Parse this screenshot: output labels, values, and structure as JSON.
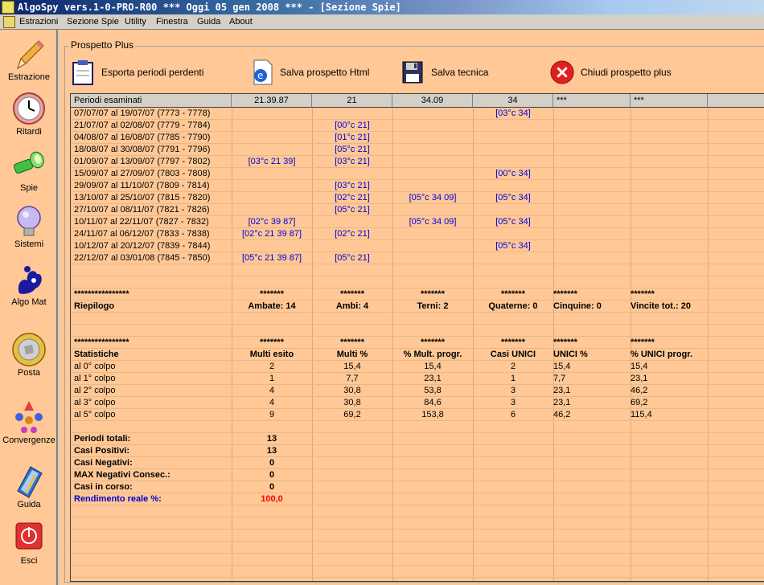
{
  "window": {
    "title": "AlgoSpy vers.1-0-PRO-R00  ***  Oggi 05 gen 2008  ***   - [Sezione Spie]"
  },
  "menu": [
    "Estrazioni",
    "Sezione Spie",
    "Utility",
    "Finestra",
    "Guida",
    "About"
  ],
  "sidebar": [
    {
      "label": "Estrazione",
      "icon": "pencil-icon"
    },
    {
      "label": "Ritardi",
      "icon": "clock-icon"
    },
    {
      "label": "Spie",
      "icon": "flashlight-icon"
    },
    {
      "label": "Sistemi",
      "icon": "lightbulb-icon"
    },
    {
      "label": "Algo Mat",
      "icon": "lottery-hand-icon"
    },
    {
      "label": "Posta",
      "icon": "coin-icon"
    },
    {
      "label": "Convergenze",
      "icon": "convergence-icon"
    },
    {
      "label": "Guida",
      "icon": "book-icon"
    },
    {
      "label": "Esci",
      "icon": "exit-icon"
    }
  ],
  "panel": {
    "title": "Prospetto Plus"
  },
  "toolbar": {
    "export": "Esporta periodi perdenti",
    "save_html": "Salva prospetto Html",
    "save_tech": "Salva tecnica",
    "close": "Chiudi prospetto plus"
  },
  "grid": {
    "headers": [
      "Periodi esaminati",
      "21.39.87",
      "21",
      "34.09",
      "34",
      "***",
      "***"
    ],
    "rows": [
      [
        "07/07/07 al 19/07/07  (7773 - 7778)",
        "",
        "",
        "",
        "[03°c 34]",
        "",
        ""
      ],
      [
        "21/07/07 al 02/08/07  (7779 - 7784)",
        "",
        "[00°c 21]",
        "",
        "",
        "",
        ""
      ],
      [
        "04/08/07 al 16/08/07  (7785 - 7790)",
        "",
        "[01°c 21]",
        "",
        "",
        "",
        ""
      ],
      [
        "18/08/07 al 30/08/07  (7791 - 7796)",
        "",
        "[05°c 21]",
        "",
        "",
        "",
        ""
      ],
      [
        "01/09/07 al 13/09/07  (7797 - 7802)",
        "[03°c 21 39]",
        "[03°c 21]",
        "",
        "",
        "",
        ""
      ],
      [
        "15/09/07 al 27/09/07  (7803 - 7808)",
        "",
        "",
        "",
        "[00°c 34]",
        "",
        ""
      ],
      [
        "29/09/07 al 11/10/07  (7809 - 7814)",
        "",
        "[03°c 21]",
        "",
        "",
        "",
        ""
      ],
      [
        "13/10/07 al 25/10/07  (7815 - 7820)",
        "",
        "[02°c 21]",
        "[05°c 34 09]",
        "[05°c 34]",
        "",
        ""
      ],
      [
        "27/10/07 al 08/11/07  (7821 - 7826)",
        "",
        "[05°c 21]",
        "",
        "",
        "",
        ""
      ],
      [
        "10/11/07 al 22/11/07  (7827 - 7832)",
        "[02°c 39 87]",
        "",
        "[05°c 34 09]",
        "[05°c 34]",
        "",
        ""
      ],
      [
        "24/11/07 al 06/12/07  (7833 - 7838)",
        "[02°c 21 39 87]",
        "[02°c 21]",
        "",
        "",
        "",
        ""
      ],
      [
        "10/12/07 al 20/12/07  (7839 - 7844)",
        "",
        "",
        "",
        "[05°c 34]",
        "",
        ""
      ],
      [
        "22/12/07 al 03/01/08  (7845 - 7850)",
        "[05°c 21 39 87]",
        "[05°c 21]",
        "",
        "",
        "",
        ""
      ]
    ],
    "summary_stars": [
      "****************",
      "*******",
      "*******",
      "*******",
      "*******",
      "*******",
      "*******"
    ],
    "summary": [
      "Riepilogo",
      "Ambate: 14",
      "Ambi: 4",
      "Terni: 2",
      "Quaterne: 0",
      "Cinquine: 0",
      "Vincite tot.: 20"
    ],
    "stats_stars": [
      "****************",
      "*******",
      "*******",
      "*******",
      "*******",
      "*******",
      "*******"
    ],
    "stats_header": [
      "Statistiche",
      "Multi esito",
      "Multi %",
      "% Mult. progr.",
      "Casi UNICI",
      "UNICI %",
      "% UNICI progr."
    ],
    "stats": [
      [
        "al 0° colpo",
        "2",
        "15,4",
        "15,4",
        "2",
        "15,4",
        "15,4"
      ],
      [
        "al 1° colpo",
        "1",
        "7,7",
        "23,1",
        "1",
        "7,7",
        "23,1"
      ],
      [
        "al 2° colpo",
        "4",
        "30,8",
        "53,8",
        "3",
        "23,1",
        "46,2"
      ],
      [
        "al 3° colpo",
        "4",
        "30,8",
        "84,6",
        "3",
        "23,1",
        "69,2"
      ],
      [
        "al 5° colpo",
        "9",
        "69,2",
        "153,8",
        "6",
        "46,2",
        "115,4"
      ]
    ],
    "totals": [
      {
        "label": "Periodi totali:",
        "value": "13"
      },
      {
        "label": "Casi Positivi:",
        "value": "13"
      },
      {
        "label": "Casi Negativi:",
        "value": "0"
      },
      {
        "label": "MAX Negativi Consec.:",
        "value": "0"
      },
      {
        "label": "Casi in corso:",
        "value": "0"
      }
    ],
    "rendimento": {
      "label": "Rendimento reale %:",
      "value": "100,0"
    }
  }
}
